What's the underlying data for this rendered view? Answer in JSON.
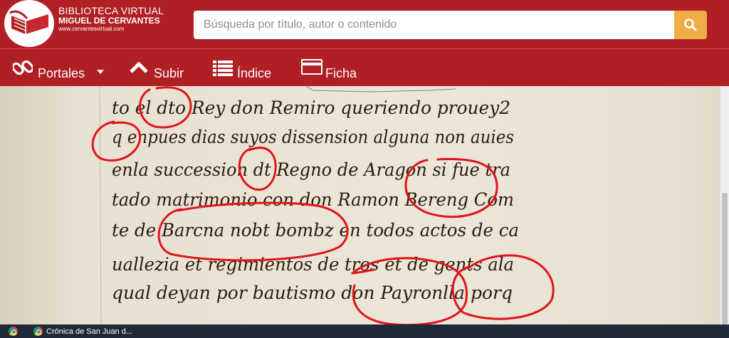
{
  "header": {
    "logo_icon": "book-logo-icon",
    "brand_line1": "BIBLIOTECA VIRTUAL",
    "brand_line2": "MIGUEL DE CERVANTES",
    "brand_line3": "www.cervantesvirtual.com",
    "search_placeholder": "Búsqueda por título, autor o contenido",
    "search_icon": "search-icon"
  },
  "colors": {
    "brand_red": "#b01f24",
    "search_button": "#f0ac45",
    "annotation_red": "#e0141b",
    "ink": "#2b1a10"
  },
  "nav": {
    "items": [
      {
        "label": "Portales",
        "icon": "link-icon",
        "has_dropdown": true
      },
      {
        "label": "Subir",
        "icon": "chevron-up-icon"
      },
      {
        "label": "Índice",
        "icon": "list-icon"
      },
      {
        "label": "Ficha",
        "icon": "card-icon"
      }
    ]
  },
  "manuscript": {
    "lines": [
      "to el dto Rey don Remiro queriendo prouey2",
      "q enpues dias suyos dissension alguna non auies",
      "enla succession dt Regno de Aragon si fue tra",
      "tado matrimonio con don Ramon Bereng Com",
      "te de Barcna nobt bombz en todos actos de ca",
      "uallezia et regimientos de tros et de gents ala",
      "qual deyan por bautismo don Payronlla porq"
    ]
  },
  "taskbar": {
    "start_icon": "chrome-icon",
    "window_icon": "chrome-icon",
    "window_title": "Crónica de San Juan d..."
  }
}
